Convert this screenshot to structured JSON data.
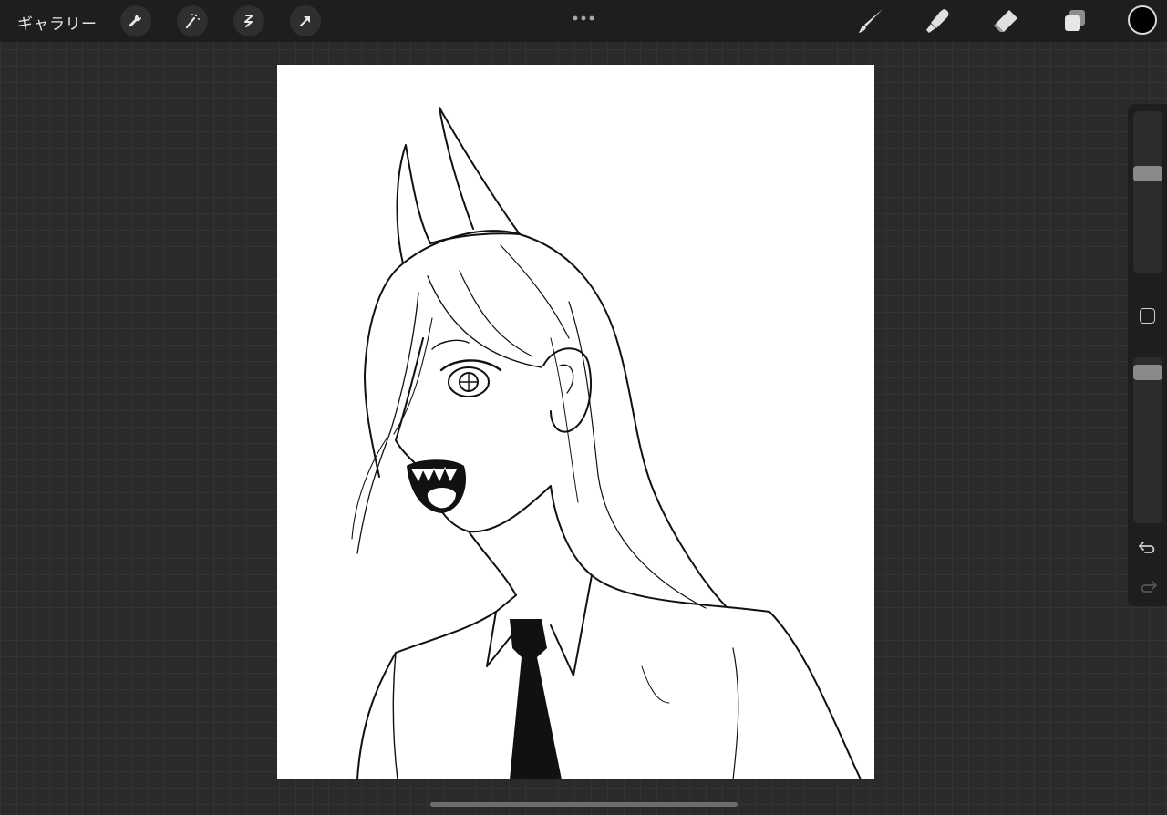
{
  "toolbar": {
    "gallery_label": "ギャラリー",
    "left_tools": [
      "wrench-icon",
      "magic-wand-icon",
      "selection-icon",
      "transform-arrow-icon"
    ],
    "more_icon": "more-dots-icon",
    "right_tools": [
      "brush-icon",
      "smudge-icon",
      "eraser-icon",
      "layers-icon"
    ],
    "current_color": "#000000"
  },
  "sidebar": {
    "brush_size": 0.37,
    "opacity": 0.95,
    "undo_icon": "undo-icon",
    "redo_icon": "redo-icon"
  },
  "canvas": {
    "background": "#ffffff",
    "content": "line-art-illustration"
  }
}
